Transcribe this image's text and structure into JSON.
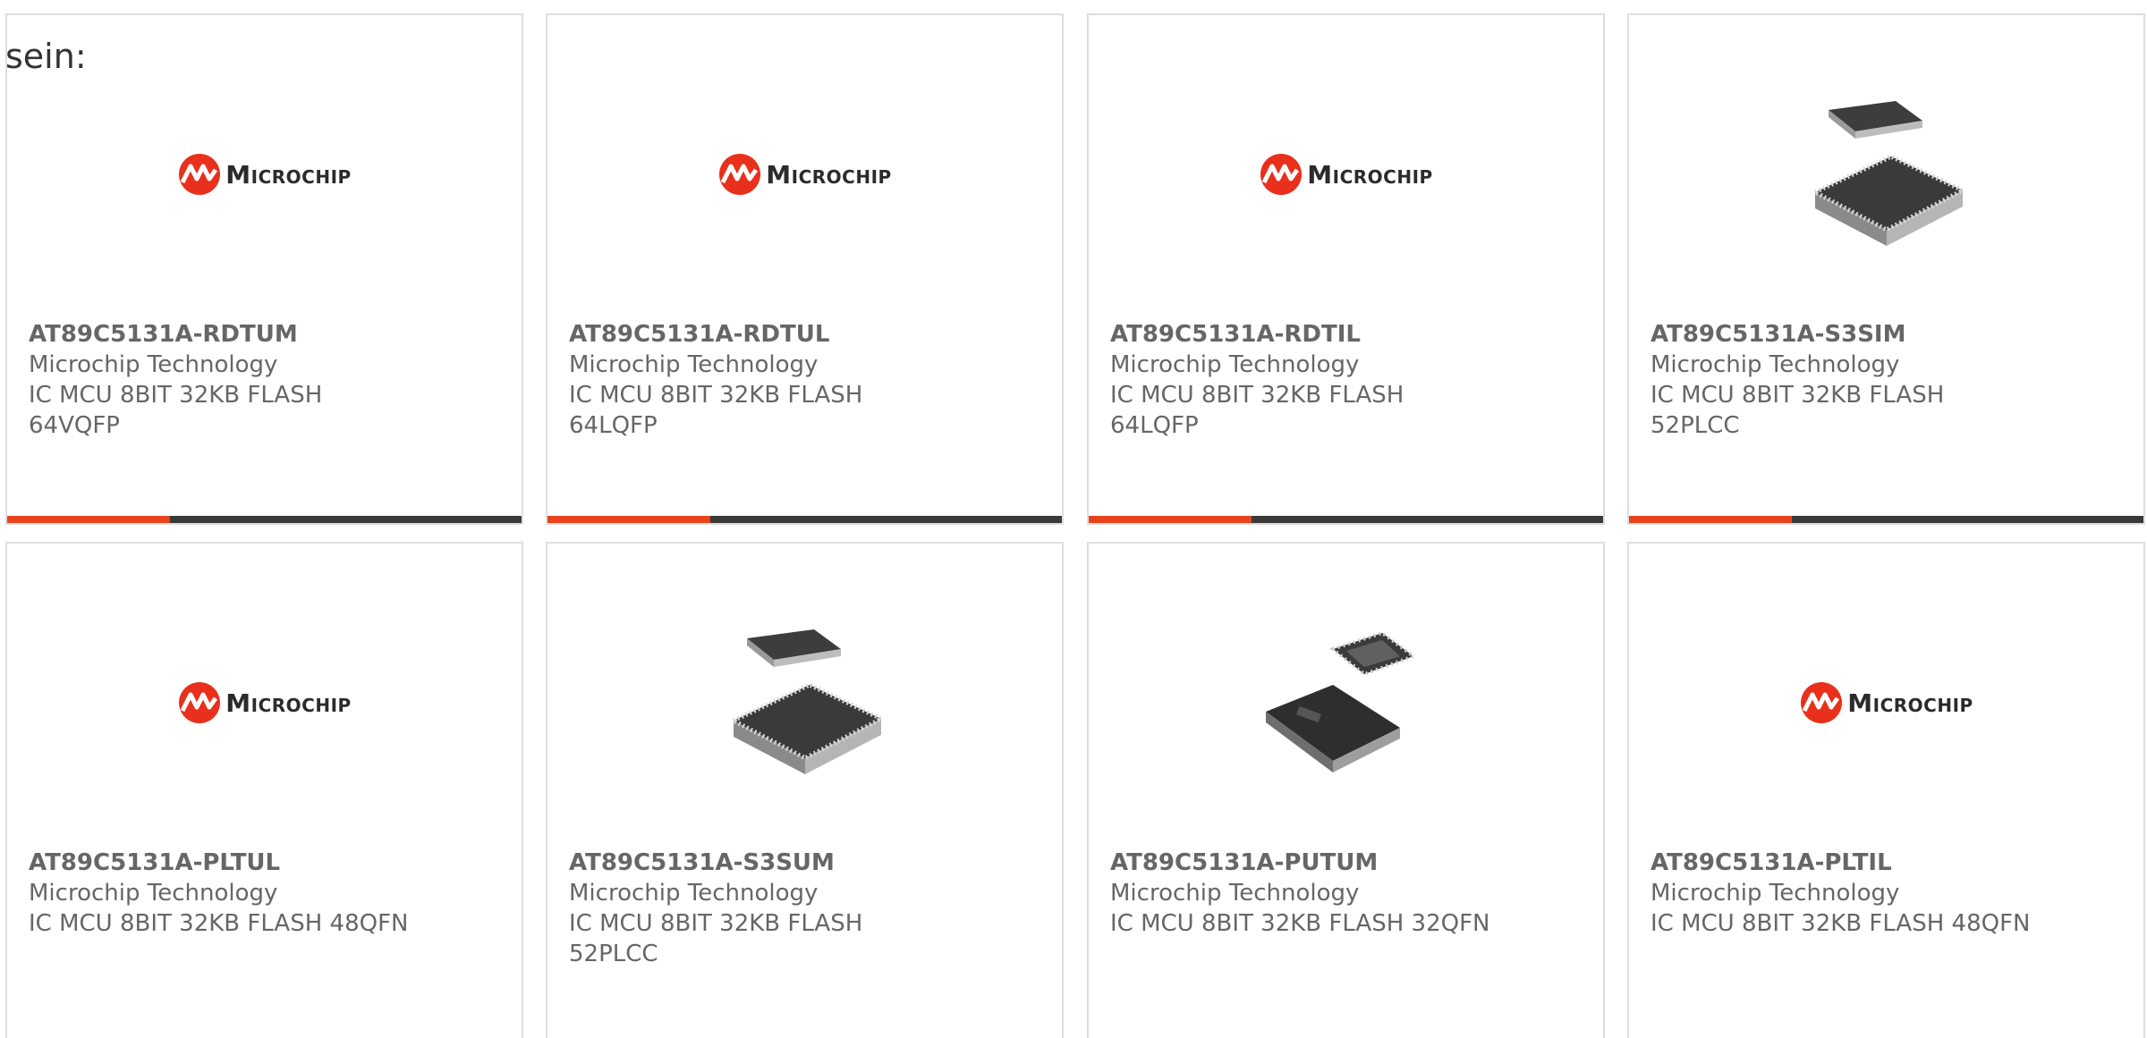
{
  "intro_text": "sein:",
  "brand": {
    "logo_text": "Microchip",
    "logo_color": "#e8301c",
    "accent_color": "#e8431c",
    "bar_color": "#3a3a3a"
  },
  "products": [
    {
      "part_number": "AT89C5131A-RDTUM",
      "manufacturer": "Microchip Technology",
      "description_line1": "IC MCU 8BIT 32KB FLASH",
      "description_line2": "64VQFP",
      "image": "microchip-logo"
    },
    {
      "part_number": "AT89C5131A-RDTUL",
      "manufacturer": "Microchip Technology",
      "description_line1": "IC MCU 8BIT 32KB FLASH",
      "description_line2": "64LQFP",
      "image": "microchip-logo"
    },
    {
      "part_number": "AT89C5131A-RDTIL",
      "manufacturer": "Microchip Technology",
      "description_line1": "IC MCU 8BIT 32KB FLASH",
      "description_line2": "64LQFP",
      "image": "microchip-logo"
    },
    {
      "part_number": "AT89C5131A-S3SIM",
      "manufacturer": "Microchip Technology",
      "description_line1": "IC MCU 8BIT 32KB FLASH",
      "description_line2": "52PLCC",
      "image": "plcc-package-photo"
    },
    {
      "part_number": "AT89C5131A-PLTUL",
      "manufacturer": "Microchip Technology",
      "description_line1": "IC MCU 8BIT 32KB FLASH 48QFN",
      "description_line2": "",
      "image": "microchip-logo"
    },
    {
      "part_number": "AT89C5131A-S3SUM",
      "manufacturer": "Microchip Technology",
      "description_line1": "IC MCU 8BIT 32KB FLASH",
      "description_line2": "52PLCC",
      "image": "plcc-package-photo"
    },
    {
      "part_number": "AT89C5131A-PUTUM",
      "manufacturer": "Microchip Technology",
      "description_line1": "IC MCU 8BIT 32KB FLASH 32QFN",
      "description_line2": "",
      "image": "qfn-package-photo"
    },
    {
      "part_number": "AT89C5131A-PLTIL",
      "manufacturer": "Microchip Technology",
      "description_line1": "IC MCU 8BIT 32KB FLASH 48QFN",
      "description_line2": "",
      "image": "microchip-logo"
    }
  ]
}
